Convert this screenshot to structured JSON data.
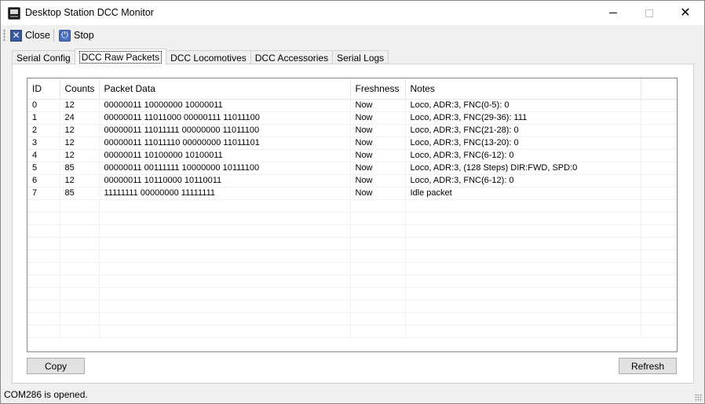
{
  "window": {
    "title": "Desktop Station DCC Monitor"
  },
  "toolbar": {
    "close_label": "Close",
    "stop_label": "Stop"
  },
  "tabs": [
    {
      "label": "Serial Config"
    },
    {
      "label": "DCC Raw Packets"
    },
    {
      "label": "DCC Locomotives"
    },
    {
      "label": "DCC Accessories"
    },
    {
      "label": "Serial Logs"
    }
  ],
  "active_tab": "DCC Raw Packets",
  "table": {
    "columns": [
      "ID",
      "Counts",
      "Packet Data",
      "Freshness",
      "Notes",
      ""
    ],
    "rows": [
      [
        "0",
        "12",
        "00000011 10000000 10000011",
        "Now",
        "Loco, ADR:3, FNC(0-5): 0"
      ],
      [
        "1",
        "24",
        "00000011 11011000 00000111 11011100",
        "Now",
        "Loco, ADR:3, FNC(29-36): 111"
      ],
      [
        "2",
        "12",
        "00000011 11011111 00000000 11011100",
        "Now",
        "Loco, ADR:3, FNC(21-28): 0"
      ],
      [
        "3",
        "12",
        "00000011 11011110 00000000 11011101",
        "Now",
        "Loco, ADR:3, FNC(13-20): 0"
      ],
      [
        "4",
        "12",
        "00000011 10100000 10100011",
        "Now",
        "Loco, ADR:3, FNC(6-12): 0"
      ],
      [
        "5",
        "85",
        "00000011 00111111 10000000 10111100",
        "Now",
        "Loco, ADR:3, (128 Steps) DIR:FWD, SPD:0"
      ],
      [
        "6",
        "12",
        "00000011 10110000 10110011",
        "Now",
        "Loco, ADR:3, FNC(6-12): 0"
      ],
      [
        "7",
        "85",
        "11111111 00000000 11111111",
        "Now",
        "Idle packet"
      ]
    ]
  },
  "buttons": {
    "copy_label": "Copy",
    "refresh_label": "Refresh"
  },
  "status": {
    "text": "COM286 is opened."
  },
  "colors": {
    "accent": "#3a5aa0"
  }
}
